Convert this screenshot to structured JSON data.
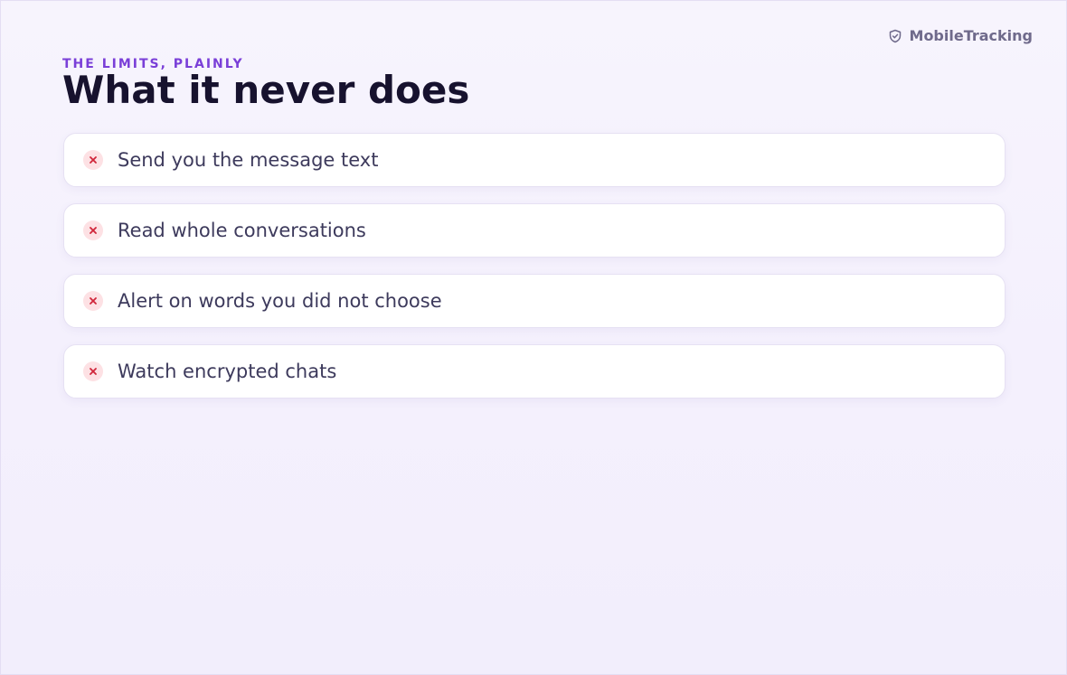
{
  "brand": {
    "name": "MobileTracking",
    "icon": "shield-check-icon",
    "color": "#6f6a8b"
  },
  "section": {
    "eyebrow": "THE LIMITS, PLAINLY",
    "title": "What it never does"
  },
  "items": [
    {
      "icon": "x-icon",
      "label": "Send you the message text"
    },
    {
      "icon": "x-icon",
      "label": "Read whole conversations"
    },
    {
      "icon": "x-icon",
      "label": "Alert on words you did not choose"
    },
    {
      "icon": "x-icon",
      "label": "Watch encrypted chats"
    }
  ],
  "colors": {
    "accent": "#7a3fd8",
    "title": "#17122e",
    "item_text": "#3d3a5c",
    "x_badge_bg": "#fde1e4",
    "x_mark": "#d0263a",
    "background": "#f5f1fd"
  }
}
